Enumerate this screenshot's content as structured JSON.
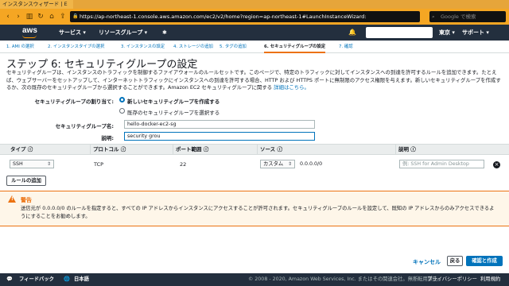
{
  "browser": {
    "tab_title": "インスタンスウィザード | E",
    "url": "https://ap-northeast-1.console.aws.amazon.com/ec2/v2/home?region=ap-northeast-1#LaunchInstanceWizard:",
    "search_placeholder": "Google で検索"
  },
  "aws_nav": {
    "logo": "aws",
    "services": "サービス ▾",
    "resource_groups": "リソースグループ ▾",
    "pin": "✱",
    "bell": "🔔",
    "region": "東京 ▾",
    "support": "サポート ▾"
  },
  "steps": [
    {
      "label": "1. AMI の選択",
      "active": false
    },
    {
      "label": "2. インスタンスタイプの選択",
      "active": false
    },
    {
      "label": "3. インスタンスの設定",
      "active": false
    },
    {
      "label": "4. ストレージの追加",
      "active": false
    },
    {
      "label": "5. タグの追加",
      "active": false
    },
    {
      "label": "6. セキュリティグループの設定",
      "active": true
    },
    {
      "label": "7. 確認",
      "active": false
    }
  ],
  "page": {
    "title": "ステップ 6: セキュリティグループの設定",
    "description": "セキュリティグループは、インスタンスのトラフィックを制御するファイアウォールのルールセットです。このページで、特定のトラフィックに対してインスタンスへの到達を許可するルールを追加できます。たとえば、ウェブサーバーをセットアップして、インターネットトラフィックにインスタンスへの到達を許可する場合、HTTP および HTTPS ポートに無制限のアクセス権限を与えます。新しいセキュリティグループを作成するか、次の既存のセキュリティグループから選択することができます。Amazon EC2 セキュリティグループに関する",
    "more_link": "詳細はこちら。"
  },
  "assign": {
    "label": "セキュリティグループの割り当て:",
    "option_new": "新しいセキュリティグループを作成する",
    "option_existing": "既存のセキュリティグループを選択する"
  },
  "form": {
    "name_label": "セキュリティグループ名:",
    "name_value": "hello-docker-ec2-sg",
    "desc_label": "説明:",
    "desc_value": "security grou"
  },
  "table": {
    "headers": [
      "タイプ ⓘ",
      "プロトコル ⓘ",
      "ポート範囲 ⓘ",
      "ソース ⓘ",
      "説明 ⓘ"
    ],
    "row": {
      "type": "SSH",
      "protocol": "TCP",
      "port": "22",
      "source_select": "カスタム",
      "source_value": "0.0.0.0/0",
      "description_placeholder": "例: SSH for Admin Desktop"
    }
  },
  "add_rule_button": "ルールの追加",
  "warning": {
    "title": "警告",
    "body": "送信元が 0.0.0.0/0 のルールを指定すると、すべての IP アドレスからインスタンスにアクセスすることが許可されます。セキュリティグループのルールを設定して、既知の IP アドレスからのみアクセスできるようにすることをお勧めします。"
  },
  "actions": {
    "cancel": "キャンセル",
    "back": "戻る",
    "review": "確認と作成"
  },
  "footer": {
    "feedback": "フィードバック",
    "language": "日本語",
    "copyright": "© 2008 - 2020, Amazon Web Services, Inc. またはその関連会社。無断転用禁止。",
    "privacy": "プライバシーポリシー",
    "terms": "利用規約"
  }
}
